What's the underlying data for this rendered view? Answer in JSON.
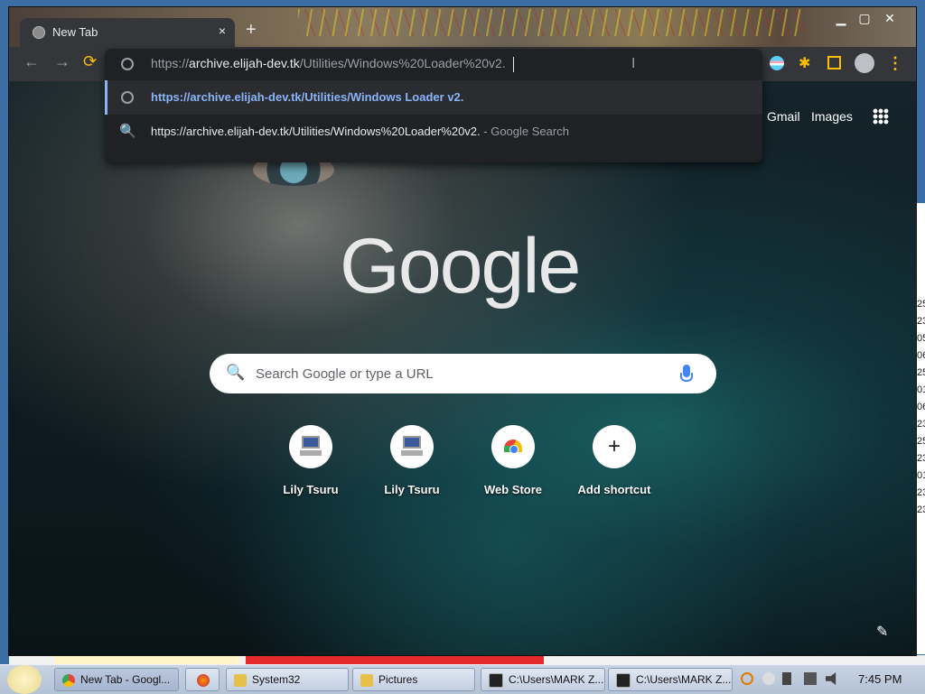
{
  "browser": {
    "tab": {
      "title": "New Tab",
      "close": "×"
    },
    "new_tab_symbol": "+",
    "window_controls": {
      "minimize": "▁",
      "maximize": "▢",
      "close": "✕"
    },
    "nav": {
      "back": "←",
      "forward": "→",
      "reload": "⟳"
    },
    "menu_symbol": "⋮",
    "puzzle_symbol": "✱",
    "omnibox": {
      "scheme": "https://",
      "host": "archive.elijah-dev.tk",
      "path": "/Utilities/Windows%20Loader%20v2."
    },
    "suggestions": [
      {
        "text": "https://archive.elijah-dev.tk/Utilities/Windows Loader v2.",
        "icon": "globe-icon"
      },
      {
        "text": "https://archive.elijah-dev.tk/Utilities/Windows%20Loader%20v2.",
        "suffix": " - Google Search",
        "icon": "search-icon"
      }
    ]
  },
  "page": {
    "top_links": {
      "gmail": "Gmail",
      "images": "Images"
    },
    "logo": "Google",
    "search_placeholder": "Search Google or type a URL",
    "search_icon": "🔍",
    "shortcuts": [
      {
        "label": "Lily Tsuru",
        "icon": "computer-icon"
      },
      {
        "label": "Lily Tsuru",
        "icon": "computer-icon"
      },
      {
        "label": "Web Store",
        "icon": "web-store-icon"
      },
      {
        "label": "Add shortcut",
        "icon": "plus-icon",
        "symbol": "+"
      }
    ],
    "customize_symbol": "✎"
  },
  "taskbar": {
    "items": [
      {
        "label": "New Tab - Googl...",
        "icon": "chrome-icon"
      },
      {
        "label": "",
        "icon": "firefox-icon"
      },
      {
        "label": "System32",
        "icon": "folder-icon"
      },
      {
        "label": "Pictures",
        "icon": "folder-icon"
      },
      {
        "label": "C:\\Users\\MARK Z...",
        "icon": "cmd-icon"
      },
      {
        "label": "C:\\Users\\MARK Z...",
        "icon": "cmd-icon"
      }
    ],
    "clock": "7:45 PM"
  },
  "background_window": {
    "cells": [
      "25",
      "23",
      "05",
      "06",
      "25",
      "01",
      "06",
      "23",
      "25",
      "23",
      "01",
      "23",
      "23"
    ]
  }
}
